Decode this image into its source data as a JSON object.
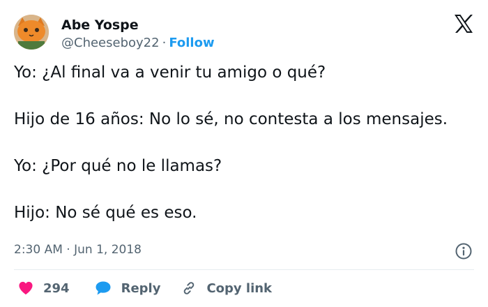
{
  "tweet": {
    "author": {
      "display_name": "Abe Yospe",
      "handle": "@Cheeseboy22",
      "separator": "·",
      "follow_label": "Follow",
      "avatar_icon": "orange-cat-avatar"
    },
    "brand_icon": "x-logo",
    "text_lines": [
      "Yo: ¿Al final va a venir tu amigo o qué?",
      "Hijo de 16 años: No lo sé, no contesta a los mensajes.",
      "Yo: ¿Por qué no le llamas?",
      "Hijo: No sé qué es eso."
    ],
    "time": "2:30 AM",
    "date_separator": "·",
    "date": "Jun 1, 2018",
    "info_icon": "info-icon",
    "actions": {
      "like_count": "294",
      "reply_label": "Reply",
      "copy_label": "Copy link"
    },
    "colors": {
      "text": "#0f1419",
      "muted": "#536471",
      "link": "#1d9bf0",
      "like": "#f91880",
      "divider": "#e6ecf0"
    }
  }
}
